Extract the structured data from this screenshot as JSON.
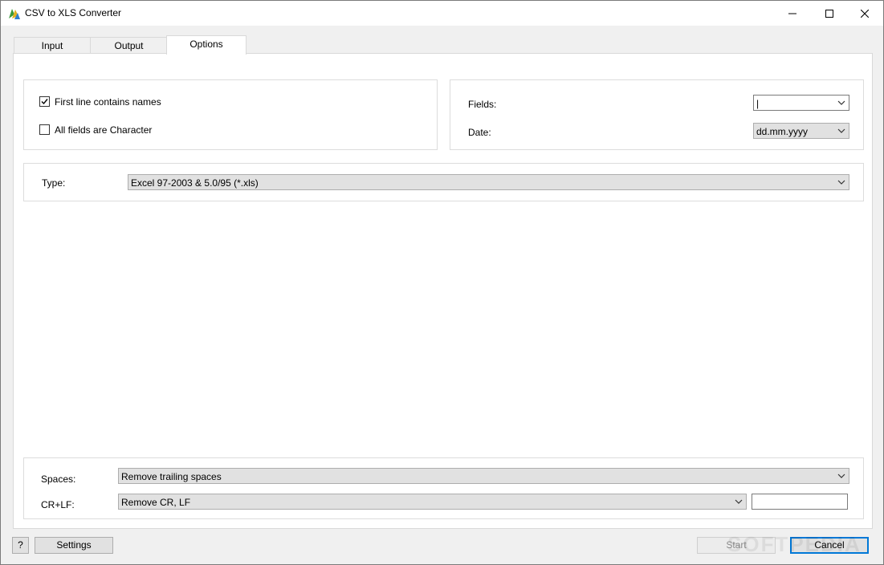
{
  "window": {
    "title": "CSV to XLS Converter"
  },
  "tabs": [
    {
      "label": "Input"
    },
    {
      "label": "Output"
    },
    {
      "label": "Options",
      "active": true
    }
  ],
  "options": {
    "first_line_names": {
      "label": "First line contains names",
      "checked": true
    },
    "all_character": {
      "label": "All fields are Character",
      "checked": false
    },
    "fields": {
      "label": "Fields:",
      "value": "|"
    },
    "date": {
      "label": "Date:",
      "value": "dd.mm.yyyy"
    },
    "type": {
      "label": "Type:",
      "value": "Excel 97-2003 & 5.0/95 (*.xls)"
    },
    "spaces": {
      "label": "Spaces:",
      "value": "Remove trailing spaces"
    },
    "crlf": {
      "label": "CR+LF:",
      "value": "Remove CR, LF",
      "replace_value": ""
    }
  },
  "footer": {
    "help_label": "?",
    "settings_label": "Settings",
    "start_label": "Start",
    "cancel_label": "Cancel",
    "watermark": "SOFTPEDIA"
  }
}
